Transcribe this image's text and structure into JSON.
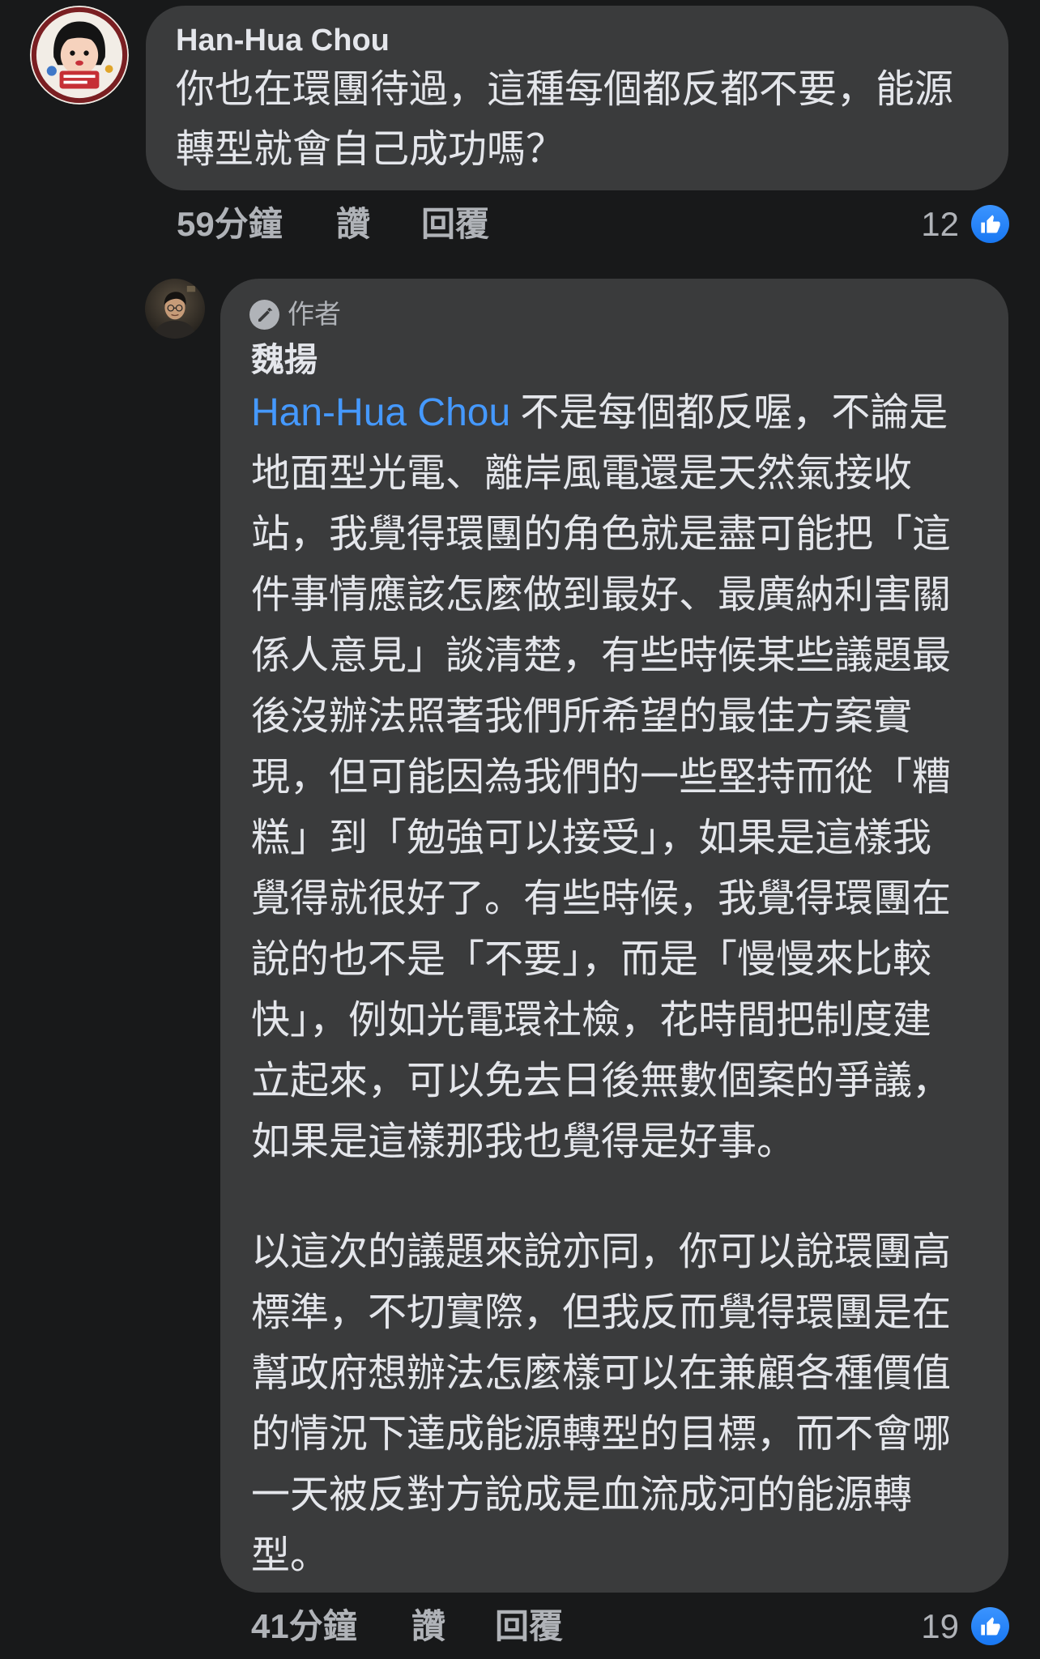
{
  "colors": {
    "background": "#18191a",
    "bubble": "#3a3b3c",
    "text": "#e4e6eb",
    "secondary": "#b0b3b8",
    "link": "#4599ff",
    "like": "#1877f2"
  },
  "icons": {
    "reaction": "thumbs-up-icon",
    "author_badge": "pencil-icon"
  },
  "comment": {
    "author": "Han-Hua Chou",
    "lines": [
      "你也在環團待過，這種每個都反都不要，能源",
      "轉型就會自己成功嗎？"
    ],
    "time": "59分鐘",
    "like_label": "讚",
    "reply_label": "回覆",
    "reaction_count": "12"
  },
  "reply": {
    "badge": "作者",
    "author": "魏揚",
    "mention": "Han-Hua Chou",
    "paragraphs": [
      [
        "不是每個都反喔，不論是",
        "地面型光電、離岸風電還是天然氣接收",
        "站，我覺得環團的角色就是盡可能把「這",
        "件事情應該怎麼做到最好、最廣納利害關",
        "係人意見」談清楚，有些時候某些議題最",
        "後沒辦法照著我們所希望的最佳方案實",
        "現，但可能因為我們的一些堅持而從「糟",
        "糕」到「勉強可以接受」，如果是這樣我",
        "覺得就很好了。有些時候，我覺得環團在",
        "說的也不是「不要」，而是「慢慢來比較",
        "快」，例如光電環社檢，花時間把制度建",
        "立起來，可以免去日後無數個案的爭議，",
        "如果是這樣那我也覺得是好事。"
      ],
      [
        "以這次的議題來說亦同，你可以說環團高",
        "標準，不切實際，但我反而覺得環團是在",
        "幫政府想辦法怎麼樣可以在兼顧各種價值",
        "的情況下達成能源轉型的目標，而不會哪",
        "一天被反對方說成是血流成河的能源轉",
        "型。"
      ]
    ],
    "time": "41分鐘",
    "like_label": "讚",
    "reply_label": "回覆",
    "reaction_count": "19"
  }
}
